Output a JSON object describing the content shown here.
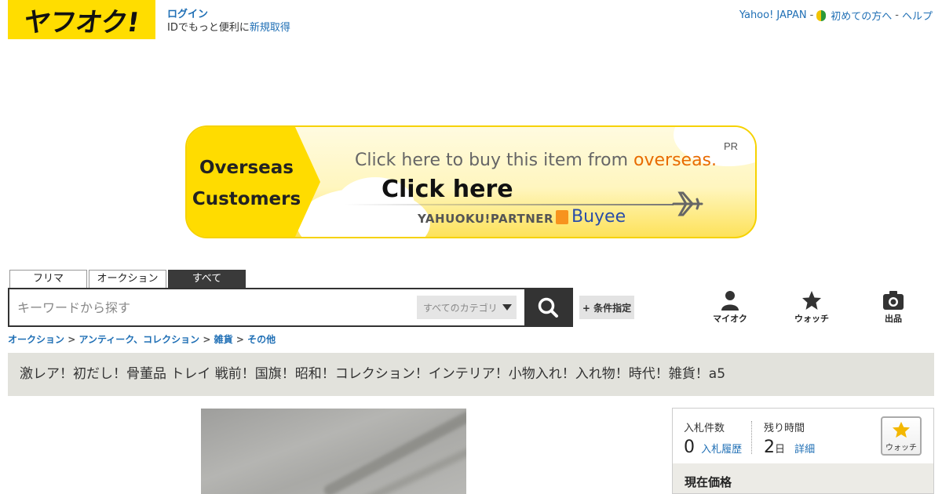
{
  "header": {
    "logo_text": "ヤフオク!",
    "login_label": "ログイン",
    "login_sub_prefix": "IDでもっと便利に",
    "signup_link": "新規取得",
    "top_links": [
      "Yahoo! JAPAN",
      "初めての方へ",
      "ヘルプ"
    ],
    "separator": "-"
  },
  "banner": {
    "left_line1": "Overseas",
    "left_line2": "Customers",
    "pr": "PR",
    "line1_prefix": "Click here to buy this item from ",
    "line1_highlight": "overseas.",
    "click_here": "Click here",
    "partner": "YAHUOKU!PARTNER",
    "brand": "Buyee"
  },
  "search": {
    "tabs": [
      "フリマ",
      "オークション",
      "すべて"
    ],
    "active_tab": "すべて",
    "placeholder": "キーワードから探す",
    "category": "すべてのカテゴリ",
    "conditions_label": "+ 条件指定"
  },
  "nav_icons": [
    {
      "label": "マイオク",
      "icon": "person-icon"
    },
    {
      "label": "ウォッチ",
      "icon": "star-icon"
    },
    {
      "label": "出品",
      "icon": "camera-icon"
    }
  ],
  "breadcrumb": {
    "items": [
      "オークション",
      "アンティーク、コレクション",
      "雑貨",
      "その他"
    ],
    "separator": ">"
  },
  "item": {
    "title": "激レア！初だし！骨董品 トレイ 戦前！国旗！昭和！コレクション！インテリア！小物入れ！入れ物！時代！雑貨！a5"
  },
  "bid_panel": {
    "bids_label": "入札件数",
    "bids_value": "0",
    "bid_history_link": "入札履歴",
    "time_label": "残り時間",
    "time_value": "2",
    "time_unit": "日",
    "detail_link": "詳細",
    "watch_label": "ウォッチ",
    "current_price_label": "現在価格"
  },
  "colors": {
    "brand_yellow": "#ffdd00",
    "link_blue": "#1f6fb5",
    "dark": "#333333",
    "title_bg": "#e2e2dc",
    "star": "#f3b700"
  }
}
